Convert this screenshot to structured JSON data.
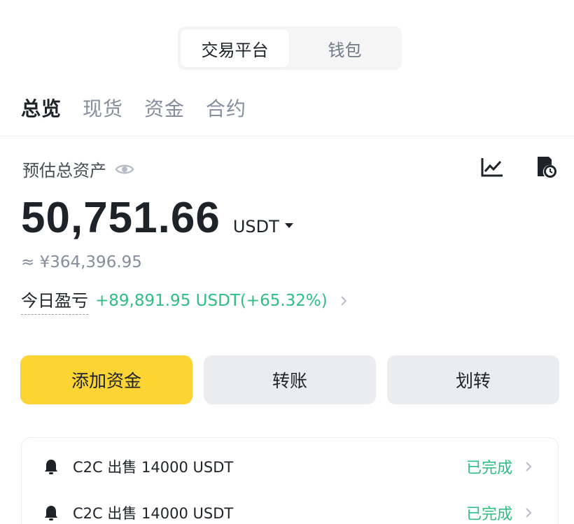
{
  "segment": {
    "active": "交易平台",
    "inactive": "钱包"
  },
  "tabs": [
    "总览",
    "现货",
    "资金",
    "合约"
  ],
  "estimate": {
    "label": "预估总资产"
  },
  "balance": {
    "value": "50,751.66",
    "currency": "USDT"
  },
  "cny_equivalent": "≈ ¥364,396.95",
  "pnl": {
    "label": "今日盈亏",
    "value": "+89,891.95 USDT(+65.32%)"
  },
  "actions": {
    "add_funds": "添加资金",
    "transfer": "转账",
    "move": "划转"
  },
  "orders": [
    {
      "text": "C2C 出售 14000 USDT",
      "status": "已完成"
    },
    {
      "text": "C2C 出售 14000 USDT",
      "status": "已完成"
    }
  ],
  "colors": {
    "accent": "#fcd535",
    "positive": "#2ebd85",
    "muted": "#848e9c"
  },
  "icons": {
    "chart": "line-chart-icon",
    "history": "history-icon",
    "eye": "eye-icon",
    "bell": "bell-icon"
  }
}
